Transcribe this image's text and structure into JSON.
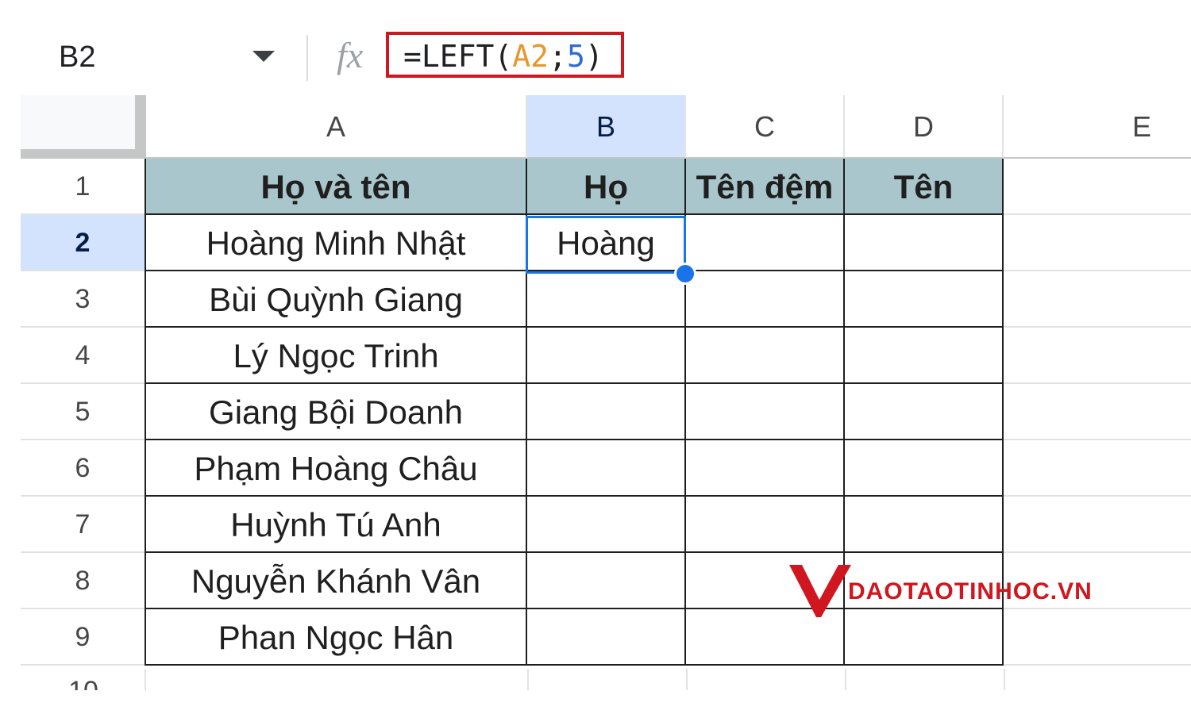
{
  "formula_bar": {
    "name_box": "B2",
    "fx_label": "fx",
    "formula_prefix": "=LEFT(",
    "formula_ref": "A2",
    "formula_sep": ";",
    "formula_num": "5",
    "formula_suffix": ")"
  },
  "columns": [
    "A",
    "B",
    "C",
    "D",
    "E"
  ],
  "selected_column": "B",
  "rows": [
    "1",
    "2",
    "3",
    "4",
    "5",
    "6",
    "7",
    "8",
    "9"
  ],
  "partial_row": "10",
  "selected_row": "2",
  "header_row": {
    "a": "Họ và tên",
    "b": "Họ",
    "c": "Tên đệm",
    "d": "Tên"
  },
  "names": [
    "Hoàng Minh Nhật",
    "Bùi Quỳnh Giang",
    "Lý Ngọc Trinh",
    "Giang Bội Doanh",
    "Phạm Hoàng Châu",
    "Huỳnh Tú Anh",
    "Nguyễn Khánh Vân",
    "Phan Ngọc Hân"
  ],
  "b2_value": "Hoàng",
  "watermark": {
    "text": "DAOTAOTINHOC.VN",
    "color": "#d0161e"
  },
  "colors": {
    "header_fill": "#a9c6cc",
    "selection": "#1a73e8",
    "selected_header": "#d3e3fd"
  }
}
